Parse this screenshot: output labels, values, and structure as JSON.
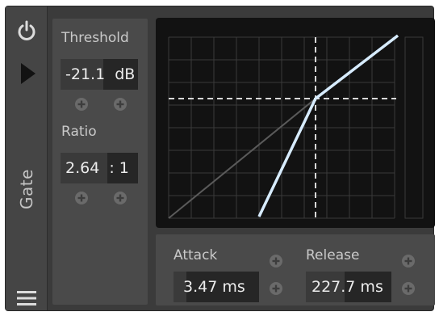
{
  "device": {
    "name": "Gate",
    "power_icon": "power-icon",
    "expand_icon": "play-triangle-icon",
    "menu_icon": "hamburger-menu-icon"
  },
  "threshold": {
    "label": "Threshold",
    "value": "-21.1",
    "unit": "dB",
    "fill_fraction": 0.55
  },
  "ratio": {
    "label": "Ratio",
    "value": "2.64",
    "unit": ": 1",
    "fill_fraction": 0.6
  },
  "attack": {
    "label": "Attack",
    "value": "3.47 ms",
    "fill_fraction": 0.15
  },
  "release": {
    "label": "Release",
    "value": "227.7 ms",
    "fill_fraction": 0.45
  },
  "colors": {
    "background": "#3b3b3b",
    "panel": "#4a4a4a",
    "graph_bg": "#121212",
    "grid": "#3a3a3a",
    "curve": "#d7ecff",
    "unity_line": "#5a5a5a",
    "text": "#c9c9c9"
  }
}
